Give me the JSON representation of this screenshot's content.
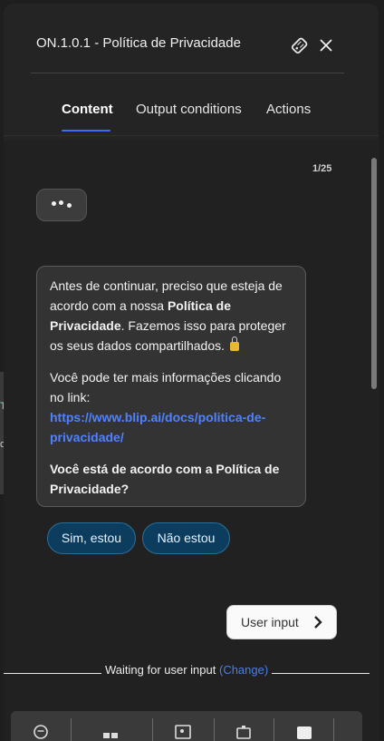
{
  "header": {
    "title": "ON.1.0.1 - Política de Privacidade",
    "icons": [
      "tag-icon",
      "close-icon"
    ]
  },
  "tabs": [
    {
      "label": "Content",
      "active": true
    },
    {
      "label": "Output conditions",
      "active": false
    },
    {
      "label": "Actions",
      "active": false
    }
  ],
  "content": {
    "counter": "1/25",
    "message": {
      "p1_a": "Antes de continuar, preciso que esteja de acordo com a nossa ",
      "p1_bold": "Política de Privacidade",
      "p1_b": ". Fazemos isso para proteger os seus dados compartilhados. ",
      "p2": "Você pode ter mais informações clicando no link:",
      "link": "https://www.blip.ai/docs/politica-de-privacidade/",
      "question": "Você está de acordo com a Política de Privacidade?"
    },
    "quick_replies": [
      "Sim, estou",
      "Não estou"
    ],
    "user_input_label": "User input",
    "waiting_text": "Waiting for user input",
    "change_label": "(Change)"
  },
  "colors": {
    "accent": "#3d6bff",
    "link": "#4f82ff",
    "quick_reply_bg": "#0c3d5e"
  }
}
